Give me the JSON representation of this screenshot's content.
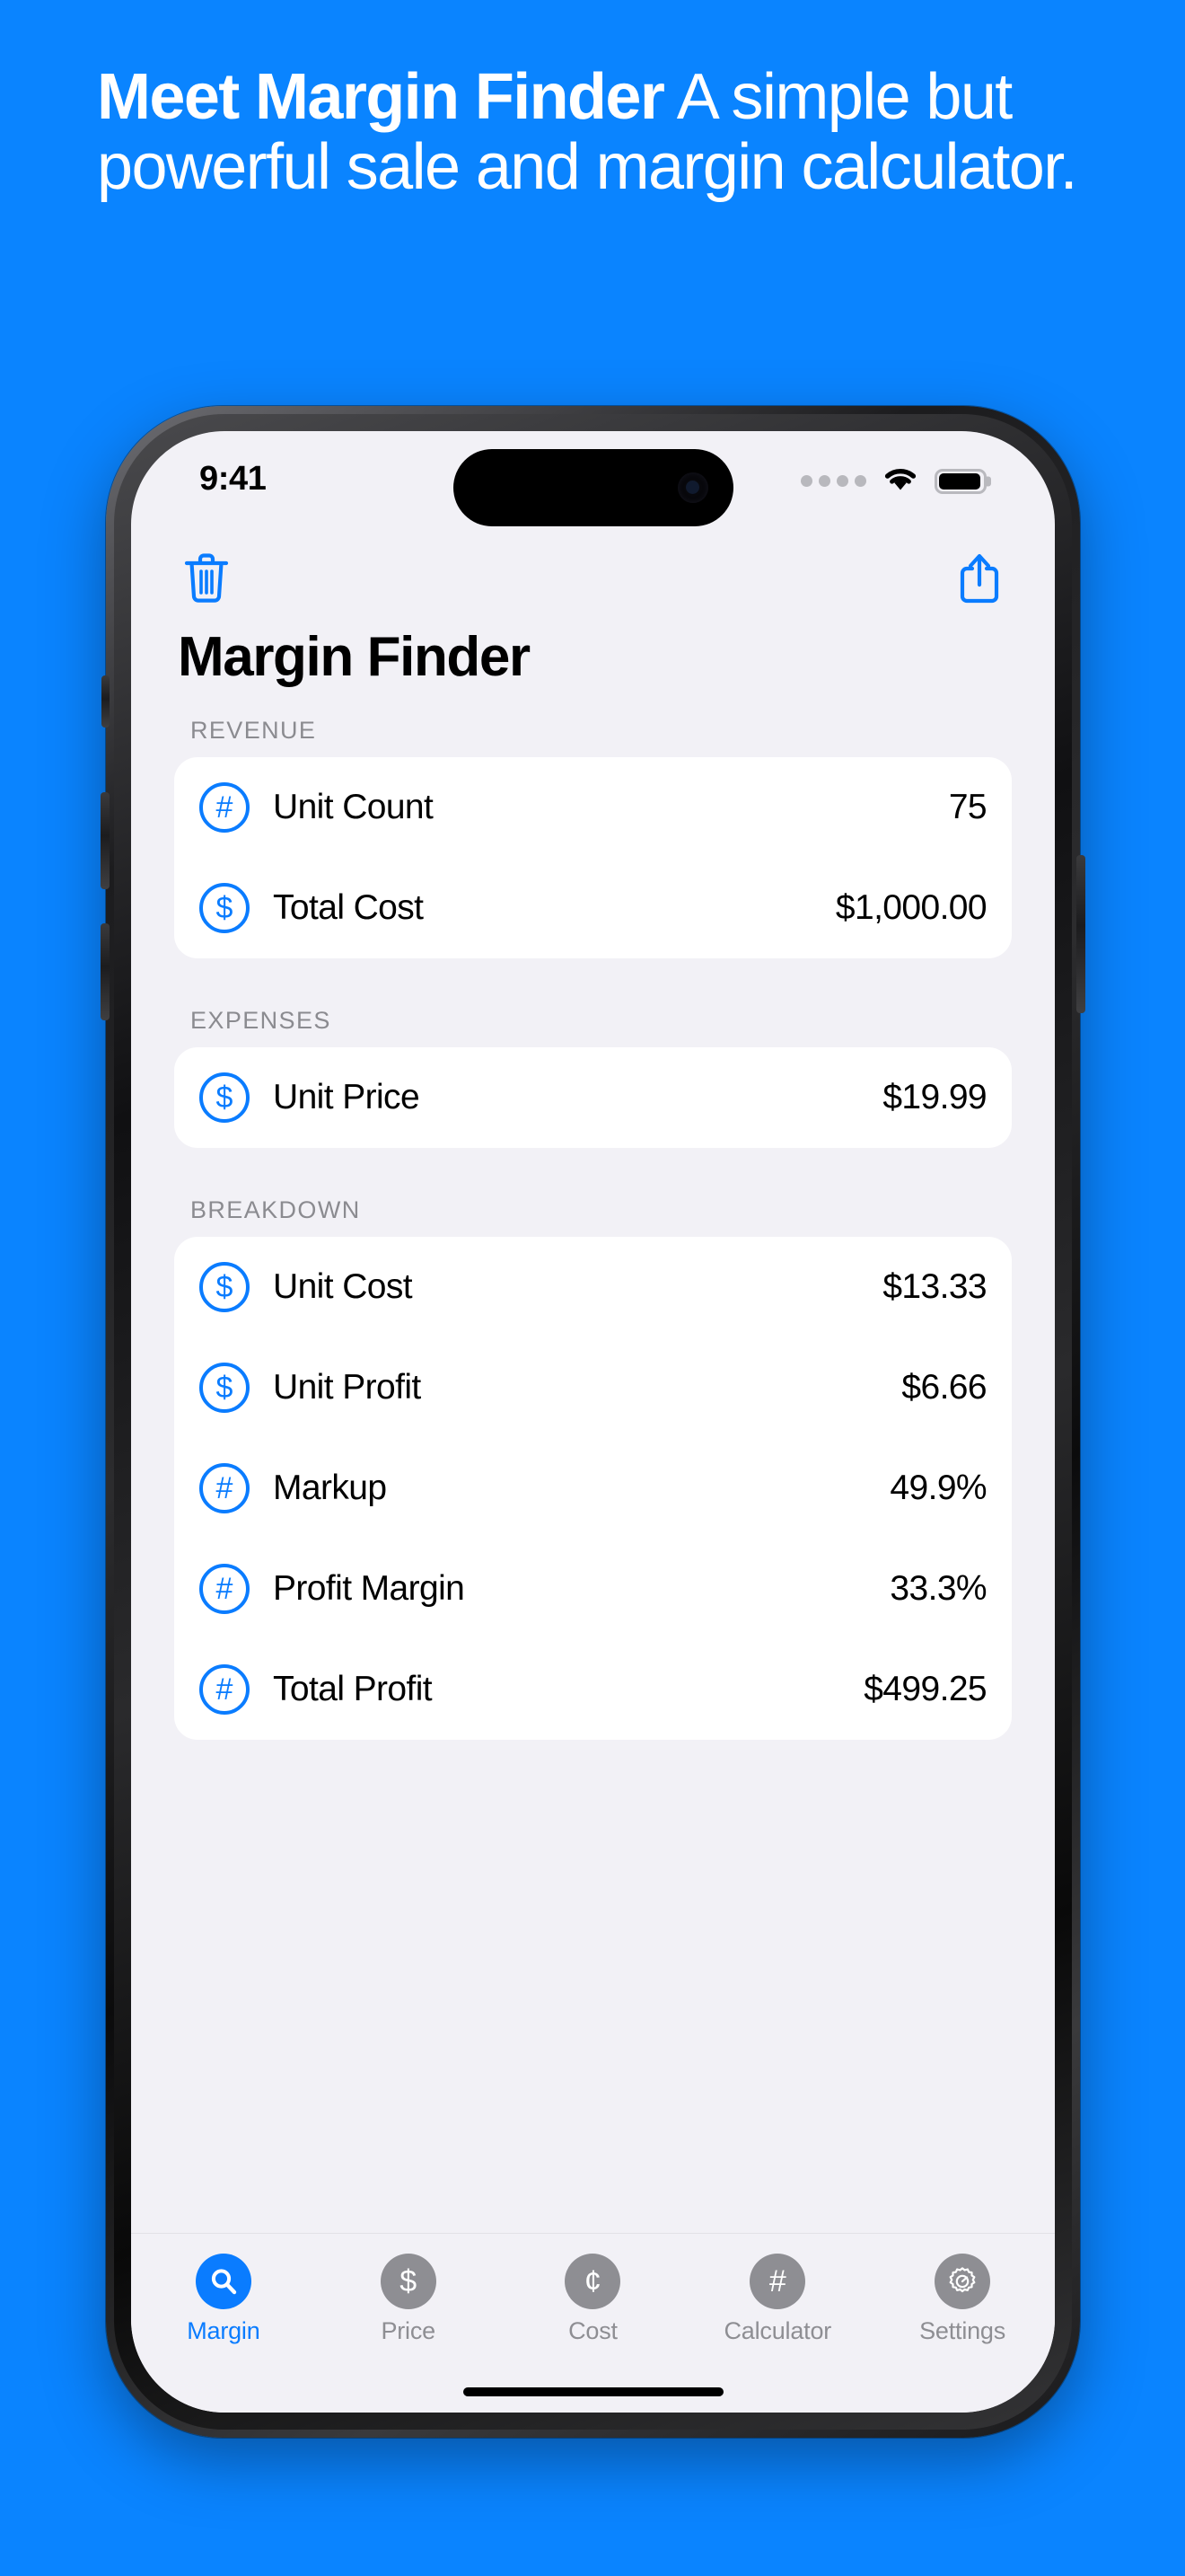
{
  "theme": {
    "background": "#0a84ff",
    "accent": "#0a7cff",
    "screen_bg": "#f2f1f6",
    "card_bg": "#ffffff",
    "muted_text": "#8e8e93"
  },
  "marketing": {
    "headline_strong": "Meet Margin Finder",
    "headline_rest": " A simple but powerful sale and margin calculator."
  },
  "status_bar": {
    "time": "9:41",
    "cellular_icon": "signal-dots-icon",
    "wifi_icon": "wifi-icon",
    "battery_icon": "battery-icon"
  },
  "toolbar": {
    "delete_icon": "trash-icon",
    "share_icon": "share-icon"
  },
  "page_title": "Margin Finder",
  "sections": [
    {
      "header": "REVENUE",
      "rows": [
        {
          "icon": "hash-circle-icon",
          "glyph": "#",
          "label": "Unit Count",
          "value": "75"
        },
        {
          "icon": "dollar-circle-icon",
          "glyph": "$",
          "label": "Total Cost",
          "value": "$1,000.00"
        }
      ]
    },
    {
      "header": "EXPENSES",
      "rows": [
        {
          "icon": "dollar-circle-icon",
          "glyph": "$",
          "label": "Unit Price",
          "value": "$19.99"
        }
      ]
    },
    {
      "header": "BREAKDOWN",
      "rows": [
        {
          "icon": "dollar-circle-icon",
          "glyph": "$",
          "label": "Unit Cost",
          "value": "$13.33"
        },
        {
          "icon": "dollar-circle-icon",
          "glyph": "$",
          "label": "Unit Profit",
          "value": "$6.66"
        },
        {
          "icon": "hash-circle-icon",
          "glyph": "#",
          "label": "Markup",
          "value": "49.9%"
        },
        {
          "icon": "hash-circle-icon",
          "glyph": "#",
          "label": "Profit Margin",
          "value": "33.3%"
        },
        {
          "icon": "hash-circle-icon",
          "glyph": "#",
          "label": "Total Profit",
          "value": "$499.25"
        }
      ]
    }
  ],
  "tab_bar": [
    {
      "label": "Margin",
      "icon": "magnifier-icon",
      "glyph": "",
      "active": true
    },
    {
      "label": "Price",
      "icon": "dollar-icon",
      "glyph": "$",
      "active": false
    },
    {
      "label": "Cost",
      "icon": "cent-icon",
      "glyph": "¢",
      "active": false
    },
    {
      "label": "Calculator",
      "icon": "hash-icon",
      "glyph": "#",
      "active": false
    },
    {
      "label": "Settings",
      "icon": "gear-icon",
      "glyph": "",
      "active": false
    }
  ]
}
